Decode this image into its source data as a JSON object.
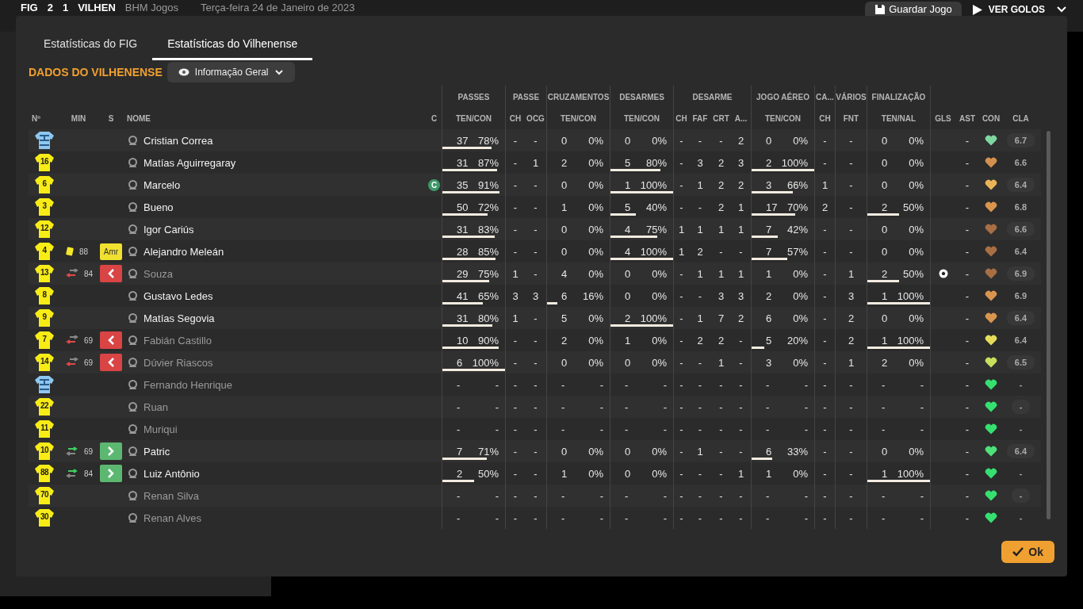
{
  "header": {
    "home_team": "FIG",
    "home_goals": "2",
    "away_goals": "1",
    "away_team": "VILHEN",
    "competition": "BHM Jogos",
    "date": "Terça-feira 24 de Janeiro de 2023",
    "save_button": "Guardar Jogo",
    "goals_button": "VER GOLOS"
  },
  "tabs": [
    {
      "label": "Estatísticas do FIG",
      "selected": false
    },
    {
      "label": "Estatísticas do Vilhenense",
      "selected": true
    }
  ],
  "section_title": "DADOS DO VILHENENSE",
  "view_dropdown": {
    "label": "Informação Geral"
  },
  "column_groups": [
    {
      "columns": [
        "Nº",
        "MIN",
        "S",
        "NOME",
        "C"
      ]
    },
    {
      "label": "PASSES",
      "columns": [
        "TEN/CON"
      ]
    },
    {
      "label": "PASSE",
      "columns": [
        "CH",
        "OCG"
      ]
    },
    {
      "label": "CRUZAMENTOS",
      "columns": [
        "TEN/CON"
      ]
    },
    {
      "label": "DESARMES",
      "columns": [
        "TEN/CON"
      ]
    },
    {
      "label": "DESARME",
      "columns": [
        "CH",
        "FAF",
        "CRT",
        "A..."
      ]
    },
    {
      "label": "JOGO AÉREO",
      "columns": [
        "TEN/CON"
      ]
    },
    {
      "label": "CA...",
      "columns": [
        "CH"
      ]
    },
    {
      "label": "VÁRIOS",
      "columns": [
        "FNT"
      ]
    },
    {
      "label": "FINALIZAÇÃO",
      "columns": [
        "TEN/NAL"
      ]
    },
    {
      "columns": [
        "GLS",
        "AST",
        "CON",
        "CLA"
      ]
    }
  ],
  "rows": [
    {
      "kind": "goalkeeper",
      "name": "Cristian Correa",
      "dimmed": false,
      "passes": {
        "ten": "37",
        "con": "78%",
        "level": 0.78
      },
      "passe": [
        "-",
        "-"
      ],
      "crosses": {
        "ten": "0",
        "con": "0%"
      },
      "tackles": {
        "ten": "0",
        "con": "0%"
      },
      "desarme": [
        "-",
        "-",
        "-",
        "2"
      ],
      "aerial": {
        "ten": "0",
        "con": "0%"
      },
      "ca": "-",
      "fnt": "-",
      "shots": {
        "ten": "0",
        "con": "0%"
      },
      "goal": false,
      "ast": "-",
      "color": "#7fd6a0",
      "rating": "6.7"
    },
    {
      "kind": "outfield",
      "number": "16",
      "name": "Matías Aguirregaray",
      "dimmed": false,
      "passes": {
        "ten": "31",
        "con": "87%",
        "level": 0.87
      },
      "passe": [
        "-",
        "1"
      ],
      "crosses": {
        "ten": "2",
        "con": "0%"
      },
      "tackles": {
        "ten": "5",
        "con": "80%",
        "level": 0.8
      },
      "desarme": [
        "-",
        "3",
        "2",
        "3"
      ],
      "aerial": {
        "ten": "2",
        "con": "100%",
        "level": 1
      },
      "ca": "-",
      "fnt": "-",
      "shots": {
        "ten": "0",
        "con": "0%"
      },
      "goal": false,
      "ast": "-",
      "color": "#d4904e",
      "rating": "6.6"
    },
    {
      "kind": "outfield",
      "number": "6",
      "name": "Marcelo",
      "dimmed": false,
      "captain_label": "C",
      "passes": {
        "ten": "35",
        "con": "91%",
        "level": 0.91
      },
      "passe": [
        "-",
        "-"
      ],
      "crosses": {
        "ten": "0",
        "con": "0%"
      },
      "tackles": {
        "ten": "1",
        "con": "100%",
        "level": 1
      },
      "desarme": [
        "-",
        "1",
        "2",
        "2"
      ],
      "aerial": {
        "ten": "3",
        "con": "66%",
        "level": 0.66
      },
      "ca": "1",
      "fnt": "-",
      "shots": {
        "ten": "0",
        "con": "0%"
      },
      "goal": false,
      "ast": "-",
      "color": "#e9b457",
      "rating": "6.4"
    },
    {
      "kind": "outfield",
      "number": "3",
      "name": "Bueno",
      "dimmed": false,
      "passes": {
        "ten": "50",
        "con": "72%",
        "level": 0.72
      },
      "passe": [
        "-",
        "-"
      ],
      "crosses": {
        "ten": "1",
        "con": "0%"
      },
      "tackles": {
        "ten": "5",
        "con": "40%",
        "level": 0.4
      },
      "desarme": [
        "-",
        "-",
        "2",
        "1"
      ],
      "aerial": {
        "ten": "17",
        "con": "70%",
        "level": 0.7
      },
      "ca": "2",
      "fnt": "-",
      "shots": {
        "ten": "2",
        "con": "50%",
        "level": 0.5
      },
      "goal": false,
      "ast": "-",
      "color": "#d9954e",
      "rating": "6.8"
    },
    {
      "kind": "outfield",
      "number": "12",
      "name": "Igor Cariús",
      "dimmed": false,
      "passes": {
        "ten": "31",
        "con": "83%",
        "level": 0.83
      },
      "passe": [
        "-",
        "-"
      ],
      "crosses": {
        "ten": "0",
        "con": "0%"
      },
      "tackles": {
        "ten": "4",
        "con": "75%",
        "level": 0.75
      },
      "desarme": [
        "1",
        "1",
        "1",
        "1"
      ],
      "aerial": {
        "ten": "7",
        "con": "42%",
        "level": 0.42
      },
      "ca": "-",
      "fnt": "-",
      "shots": {
        "ten": "0",
        "con": "0%"
      },
      "goal": false,
      "ast": "-",
      "color": "#a86e44",
      "rating": "6.6"
    },
    {
      "kind": "outfield",
      "number": "4",
      "event": {
        "kind": "yellow_card",
        "minute": "88"
      },
      "status": {
        "kind": "booked",
        "label": "Amr"
      },
      "name": "Alejandro Meleán",
      "dimmed": false,
      "passes": {
        "ten": "28",
        "con": "85%",
        "level": 0.85
      },
      "passe": [
        "-",
        "-"
      ],
      "crosses": {
        "ten": "0",
        "con": "0%"
      },
      "tackles": {
        "ten": "4",
        "con": "100%",
        "level": 1
      },
      "desarme": [
        "1",
        "2",
        "-",
        "-"
      ],
      "aerial": {
        "ten": "7",
        "con": "57%",
        "level": 0.57
      },
      "ca": "-",
      "fnt": "-",
      "shots": {
        "ten": "0",
        "con": "0%"
      },
      "goal": false,
      "ast": "-",
      "color": "#a86e44",
      "rating": "6.4"
    },
    {
      "kind": "outfield",
      "number": "13",
      "event": {
        "kind": "sub_off",
        "minute": "84"
      },
      "status": {
        "kind": "off"
      },
      "name": "Souza",
      "dimmed": true,
      "passes": {
        "ten": "29",
        "con": "75%",
        "level": 0.75
      },
      "passe": [
        "1",
        "-"
      ],
      "crosses": {
        "ten": "4",
        "con": "0%"
      },
      "tackles": {
        "ten": "0",
        "con": "0%"
      },
      "desarme": [
        "-",
        "1",
        "1",
        "1"
      ],
      "aerial": {
        "ten": "1",
        "con": "0%"
      },
      "ca": "-",
      "fnt": "1",
      "shots": {
        "ten": "2",
        "con": "50%",
        "level": 0.5
      },
      "goal": true,
      "ast": "-",
      "color": "#a86e44",
      "rating": "6.9"
    },
    {
      "kind": "outfield",
      "number": "8",
      "name": "Gustavo Ledes",
      "dimmed": false,
      "passes": {
        "ten": "41",
        "con": "65%",
        "level": 0.65
      },
      "passe": [
        "3",
        "3"
      ],
      "crosses": {
        "ten": "6",
        "con": "16%",
        "level": 0.16
      },
      "tackles": {
        "ten": "0",
        "con": "0%"
      },
      "desarme": [
        "-",
        "-",
        "3",
        "3"
      ],
      "aerial": {
        "ten": "2",
        "con": "0%"
      },
      "ca": "-",
      "fnt": "3",
      "shots": {
        "ten": "1",
        "con": "100%",
        "level": 1
      },
      "goal": false,
      "ast": "-",
      "color": "#d9954e",
      "rating": "6.9"
    },
    {
      "kind": "outfield",
      "number": "9",
      "name": "Matías Segovia",
      "dimmed": false,
      "passes": {
        "ten": "31",
        "con": "80%",
        "level": 0.8
      },
      "passe": [
        "1",
        "-"
      ],
      "crosses": {
        "ten": "5",
        "con": "0%"
      },
      "tackles": {
        "ten": "2",
        "con": "100%",
        "level": 1
      },
      "desarme": [
        "-",
        "1",
        "7",
        "2"
      ],
      "aerial": {
        "ten": "6",
        "con": "0%"
      },
      "ca": "-",
      "fnt": "2",
      "shots": {
        "ten": "0",
        "con": "0%"
      },
      "goal": false,
      "ast": "-",
      "color": "#d9954e",
      "rating": "6.4"
    },
    {
      "kind": "outfield",
      "number": "7",
      "event": {
        "kind": "sub_off",
        "minute": "69"
      },
      "status": {
        "kind": "off"
      },
      "name": "Fabián Castillo",
      "dimmed": true,
      "passes": {
        "ten": "10",
        "con": "90%",
        "level": 0.9
      },
      "passe": [
        "-",
        "-"
      ],
      "crosses": {
        "ten": "2",
        "con": "0%"
      },
      "tackles": {
        "ten": "1",
        "con": "0%"
      },
      "desarme": [
        "-",
        "2",
        "2",
        "-"
      ],
      "aerial": {
        "ten": "5",
        "con": "20%",
        "level": 0.2
      },
      "ca": "-",
      "fnt": "2",
      "shots": {
        "ten": "1",
        "con": "100%",
        "level": 1
      },
      "goal": false,
      "ast": "-",
      "color": "#e6dc5a",
      "rating": "6.4"
    },
    {
      "kind": "outfield",
      "number": "14",
      "event": {
        "kind": "sub_off",
        "minute": "69"
      },
      "status": {
        "kind": "off"
      },
      "name": "Dúvier Riascos",
      "dimmed": true,
      "passes": {
        "ten": "6",
        "con": "100%",
        "level": 1
      },
      "passe": [
        "-",
        "-"
      ],
      "crosses": {
        "ten": "0",
        "con": "0%"
      },
      "tackles": {
        "ten": "0",
        "con": "0%"
      },
      "desarme": [
        "-",
        "-",
        "1",
        "-"
      ],
      "aerial": {
        "ten": "3",
        "con": "0%"
      },
      "ca": "-",
      "fnt": "1",
      "shots": {
        "ten": "2",
        "con": "0%"
      },
      "goal": false,
      "ast": "-",
      "color": "#c6df5e",
      "rating": "6.5"
    },
    {
      "kind": "goalkeeper",
      "name": "Fernando Henrique",
      "dimmed": true,
      "passes": {
        "ten": "-",
        "con": "-"
      },
      "passe": [
        "-",
        "-"
      ],
      "crosses": {
        "ten": "-",
        "con": "-"
      },
      "tackles": {
        "ten": "-",
        "con": "-"
      },
      "desarme": [
        "-",
        "-",
        "-",
        "-"
      ],
      "aerial": {
        "ten": "-",
        "con": "-"
      },
      "ca": "-",
      "fnt": "-",
      "shots": {
        "ten": "-",
        "con": "-"
      },
      "goal": false,
      "ast": "-",
      "color": "#35e070",
      "rating": "-"
    },
    {
      "kind": "outfield",
      "number": "22",
      "name": "Ruan",
      "dimmed": true,
      "passes": {
        "ten": "-",
        "con": "-"
      },
      "passe": [
        "-",
        "-"
      ],
      "crosses": {
        "ten": "-",
        "con": "-"
      },
      "tackles": {
        "ten": "-",
        "con": "-"
      },
      "desarme": [
        "-",
        "-",
        "-",
        "-"
      ],
      "aerial": {
        "ten": "-",
        "con": "-"
      },
      "ca": "-",
      "fnt": "-",
      "shots": {
        "ten": "-",
        "con": "-"
      },
      "goal": false,
      "ast": "-",
      "color": "#35e070",
      "rating": "-"
    },
    {
      "kind": "outfield",
      "number": "11",
      "name": "Muriqui",
      "dimmed": true,
      "passes": {
        "ten": "-",
        "con": "-"
      },
      "passe": [
        "-",
        "-"
      ],
      "crosses": {
        "ten": "-",
        "con": "-"
      },
      "tackles": {
        "ten": "-",
        "con": "-"
      },
      "desarme": [
        "-",
        "-",
        "-",
        "-"
      ],
      "aerial": {
        "ten": "-",
        "con": "-"
      },
      "ca": "-",
      "fnt": "-",
      "shots": {
        "ten": "-",
        "con": "-"
      },
      "goal": false,
      "ast": "-",
      "color": "#35e070",
      "rating": "-"
    },
    {
      "kind": "outfield",
      "number": "10",
      "event": {
        "kind": "sub_on",
        "minute": "69"
      },
      "status": {
        "kind": "on"
      },
      "name": "Patric",
      "dimmed": false,
      "passes": {
        "ten": "7",
        "con": "71%",
        "level": 0.71
      },
      "passe": [
        "-",
        "-"
      ],
      "crosses": {
        "ten": "0",
        "con": "0%"
      },
      "tackles": {
        "ten": "0",
        "con": "0%"
      },
      "desarme": [
        "-",
        "1",
        "-",
        "-"
      ],
      "aerial": {
        "ten": "6",
        "con": "33%",
        "level": 0.33
      },
      "ca": "-",
      "fnt": "-",
      "shots": {
        "ten": "0",
        "con": "0%"
      },
      "goal": false,
      "ast": "-",
      "color": "#4fe07a",
      "rating": "6.4"
    },
    {
      "kind": "outfield",
      "number": "88",
      "event": {
        "kind": "sub_on",
        "minute": "84"
      },
      "status": {
        "kind": "on"
      },
      "name": "Luiz Antônio",
      "dimmed": false,
      "passes": {
        "ten": "2",
        "con": "50%",
        "level": 0.5
      },
      "passe": [
        "-",
        "-"
      ],
      "crosses": {
        "ten": "1",
        "con": "0%"
      },
      "tackles": {
        "ten": "0",
        "con": "0%"
      },
      "desarme": [
        "-",
        "-",
        "-",
        "1"
      ],
      "aerial": {
        "ten": "1",
        "con": "0%"
      },
      "ca": "-",
      "fnt": "-",
      "shots": {
        "ten": "1",
        "con": "100%",
        "level": 1
      },
      "goal": false,
      "ast": "-",
      "color": "#35e070",
      "rating": "-"
    },
    {
      "kind": "outfield",
      "number": "70",
      "name": "Renan Silva",
      "dimmed": true,
      "passes": {
        "ten": "-",
        "con": "-"
      },
      "passe": [
        "-",
        "-"
      ],
      "crosses": {
        "ten": "-",
        "con": "-"
      },
      "tackles": {
        "ten": "-",
        "con": "-"
      },
      "desarme": [
        "-",
        "-",
        "-",
        "-"
      ],
      "aerial": {
        "ten": "-",
        "con": "-"
      },
      "ca": "-",
      "fnt": "-",
      "shots": {
        "ten": "-",
        "con": "-"
      },
      "goal": false,
      "ast": "-",
      "color": "#35e070",
      "rating": "-"
    },
    {
      "kind": "outfield",
      "number": "30",
      "name": "Renan Alves",
      "dimmed": true,
      "passes": {
        "ten": "-",
        "con": "-"
      },
      "passe": [
        "-",
        "-"
      ],
      "crosses": {
        "ten": "-",
        "con": "-"
      },
      "tackles": {
        "ten": "-",
        "con": "-"
      },
      "desarme": [
        "-",
        "-",
        "-",
        "-"
      ],
      "aerial": {
        "ten": "-",
        "con": "-"
      },
      "ca": "-",
      "fnt": "-",
      "shots": {
        "ten": "-",
        "con": "-"
      },
      "goal": false,
      "ast": "-",
      "color": "#35e070",
      "rating": "-"
    }
  ],
  "ok_button": "Ok"
}
